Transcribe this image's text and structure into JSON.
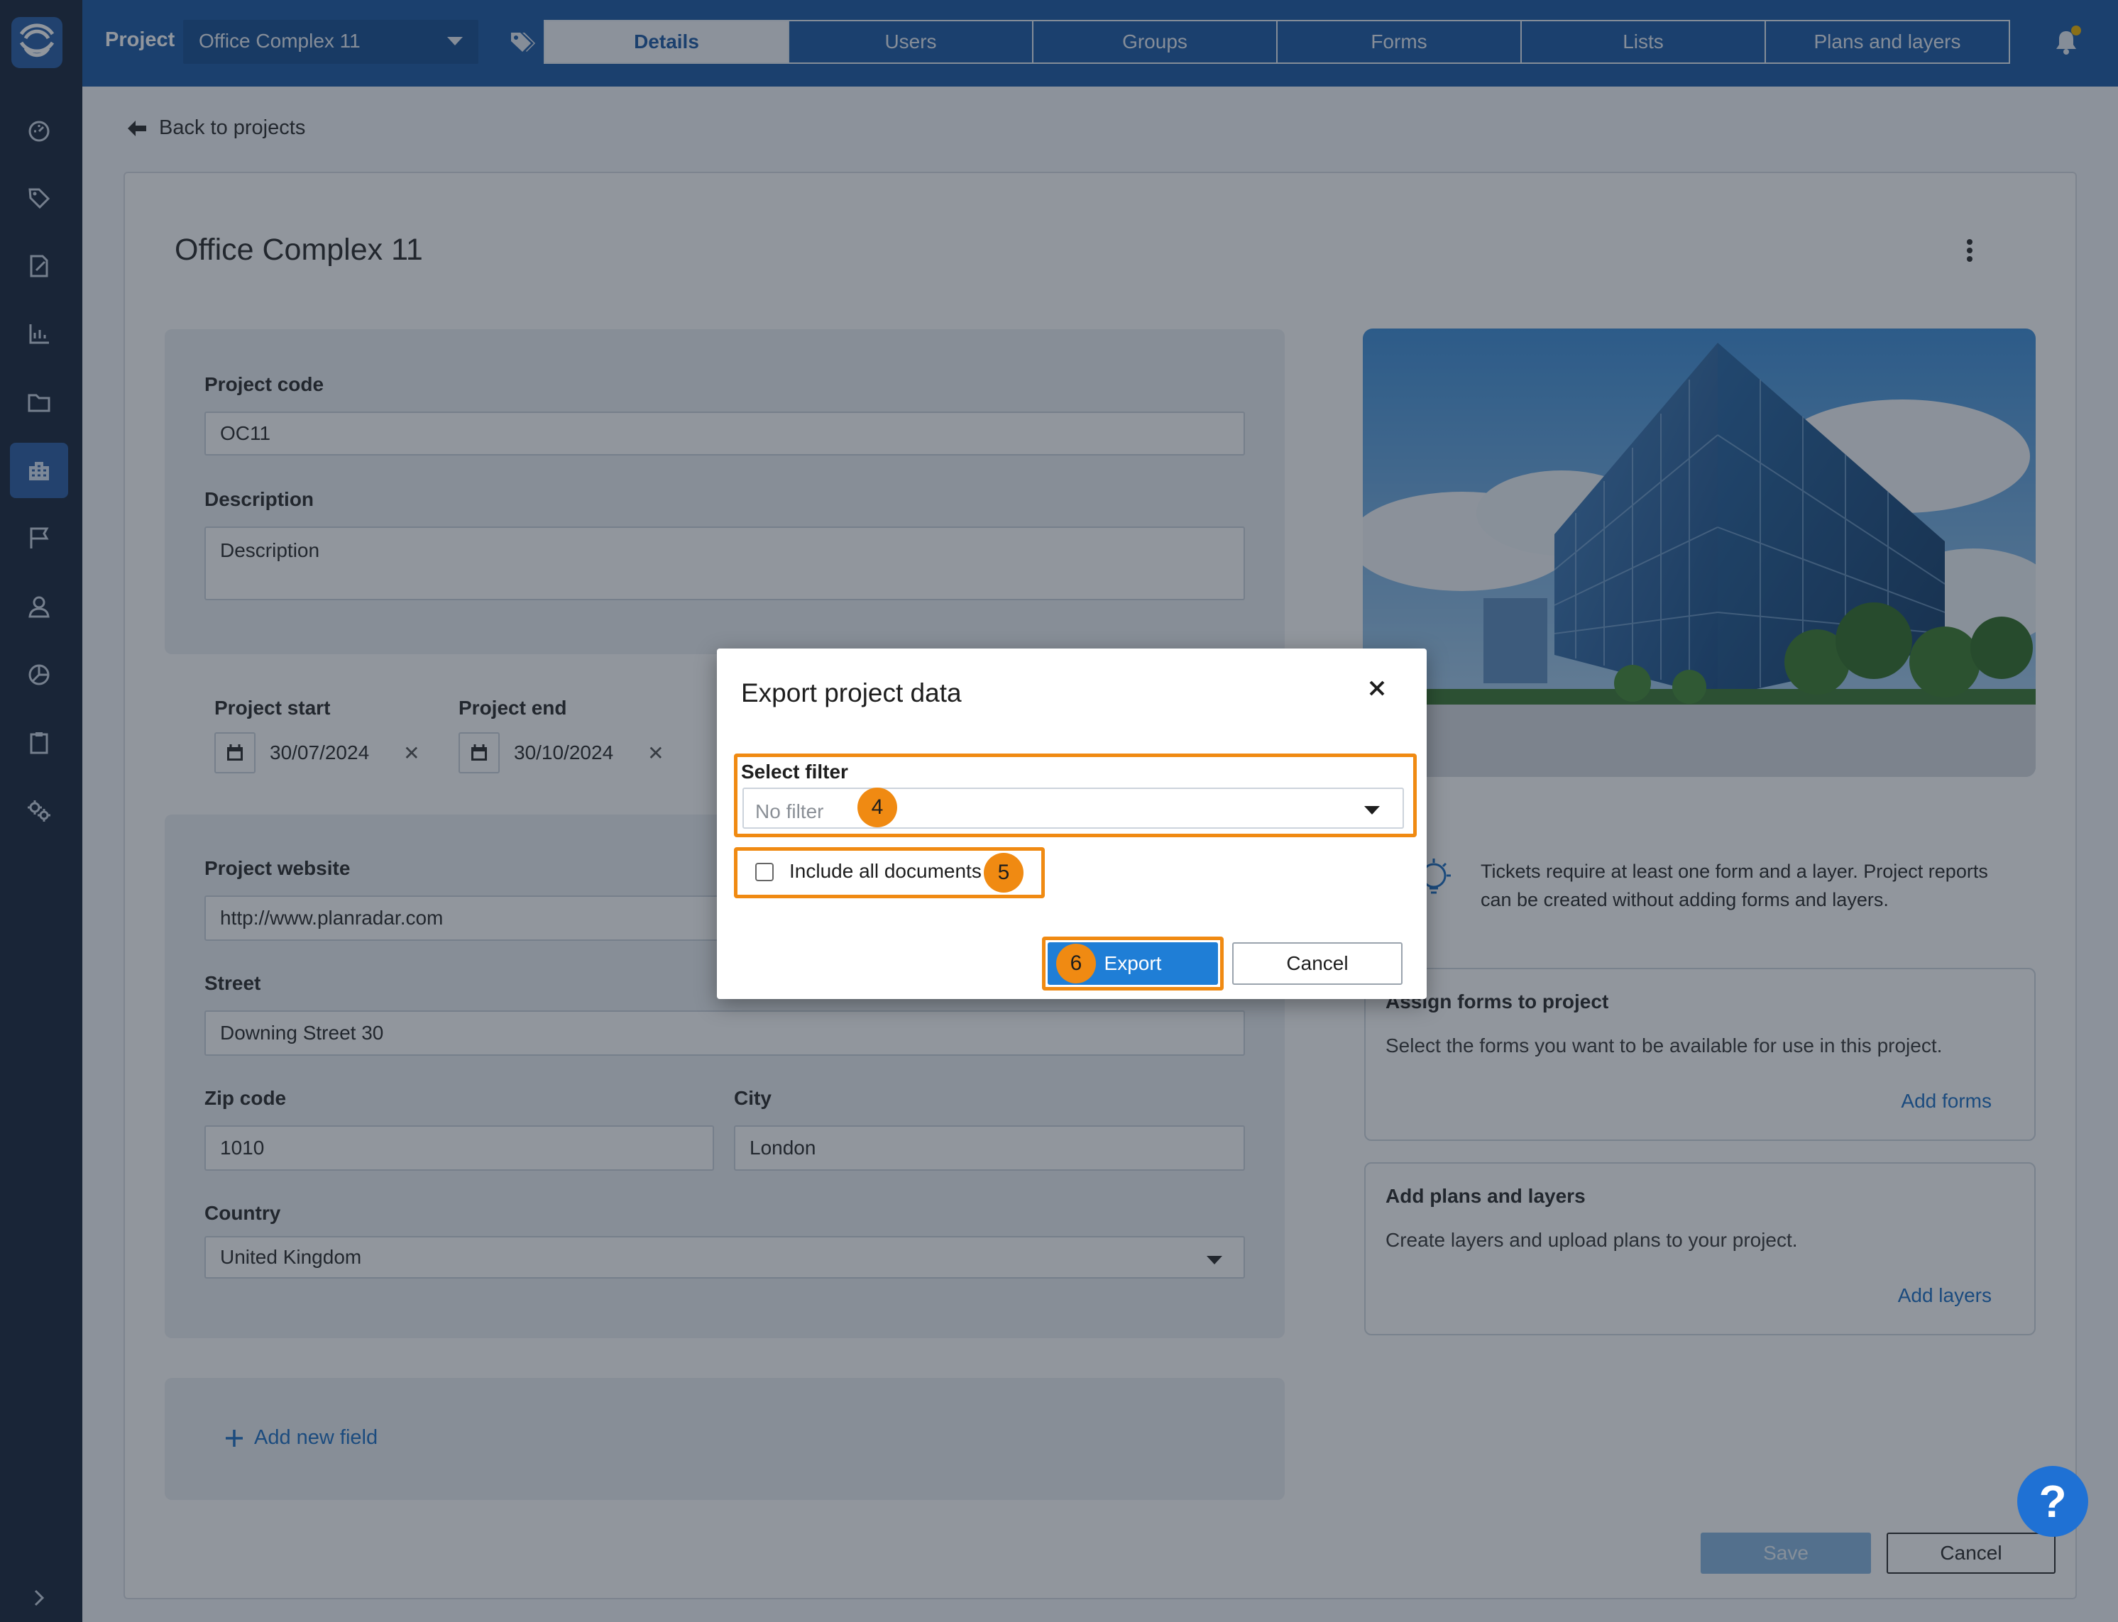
{
  "sidebar": {
    "items": [
      {
        "icon": "dashboard-icon"
      },
      {
        "icon": "tag-icon"
      },
      {
        "icon": "edit-document-icon"
      },
      {
        "icon": "chart-icon"
      },
      {
        "icon": "folder-icon"
      },
      {
        "icon": "projects-icon",
        "active": true
      },
      {
        "icon": "flag-icon"
      },
      {
        "icon": "user-icon"
      },
      {
        "icon": "pie-chart-icon"
      },
      {
        "icon": "clipboard-icon"
      },
      {
        "icon": "settings-icon"
      }
    ]
  },
  "topbar": {
    "project_label": "Project",
    "project_name": "Office Complex 11",
    "tabs": [
      "Details",
      "Users",
      "Groups",
      "Forms",
      "Lists",
      "Plans and layers"
    ],
    "active_tab": "Details"
  },
  "main": {
    "back_link": "Back to projects",
    "title": "Office Complex 11",
    "project_code_label": "Project code",
    "project_code": "OC11",
    "description_label": "Description",
    "description_value": "Description",
    "project_start_label": "Project start",
    "project_start": "30/07/2024",
    "project_end_label": "Project end",
    "project_end": "30/10/2024",
    "clear_symbol": "✕",
    "website_label": "Project website",
    "website": "http://www.planradar.com",
    "street_label": "Street",
    "street": "Downing Street 30",
    "zip_label": "Zip code",
    "zip": "1010",
    "city_label": "City",
    "city": "London",
    "country_label": "Country",
    "country": "United Kingdom",
    "add_field": "Add new field",
    "info_text": "Tickets require at least one form and a layer. Project reports can be created without adding forms and layers.",
    "forms_card": {
      "title": "Assign forms to project",
      "text": "Select the forms you want to be available for use in this project.",
      "action": "Add forms"
    },
    "layers_card": {
      "title": "Add plans and layers",
      "text": "Create layers and upload plans to your project.",
      "action": "Add layers"
    },
    "save": "Save",
    "cancel": "Cancel",
    "help": "?"
  },
  "dialog": {
    "title": "Export project data",
    "filter_label": "Select filter",
    "filter_placeholder": "No filter",
    "include_docs_label": "Include all documents",
    "include_docs_checked": false,
    "export": "Export",
    "cancel": "Cancel",
    "steps": [
      "4",
      "5",
      "6"
    ],
    "highlight_color": "#f08a12"
  },
  "colors": {
    "sidebar": "#19283d",
    "topbar": "#1d5ba6",
    "accent": "#1f7ed6",
    "link": "#1d6fc4"
  }
}
